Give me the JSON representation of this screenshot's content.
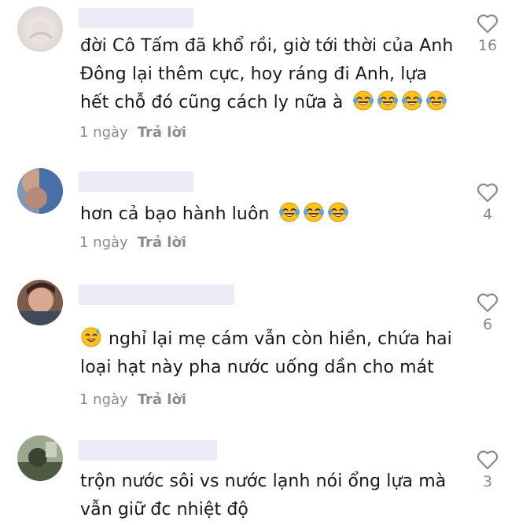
{
  "comments": [
    {
      "text": "đời Cô Tấm đã khổ rồi, giờ tới thời của Anh Đông lại thêm cực, hoy ráng đi Anh, lựa hết chỗ đó cũng cách ly nữa à",
      "emoji_prefix": [],
      "emoji_suffix": [
        "laughing-tears-emoji",
        "laughing-tears-emoji",
        "laughing-tears-emoji",
        "laughing-tears-emoji"
      ],
      "time": "1 ngày",
      "reply_label": "Trả lời",
      "likes": "16",
      "avatar_color": "#e9e4e2"
    },
    {
      "text": "hơn cả bạo hành luôn",
      "emoji_prefix": [],
      "emoji_suffix": [
        "laughing-tears-emoji",
        "laughing-tears-emoji",
        "laughing-tears-emoji"
      ],
      "time": "1 ngày",
      "reply_label": "Trả lời",
      "likes": "4",
      "avatar_color": "#8fa6c4"
    },
    {
      "text": "nghỉ lại mẹ cám vẫn còn hiền, chứa hai loại hạt này pha nước uống dần cho mát",
      "emoji_prefix": [
        "sweat-smile-emoji"
      ],
      "emoji_suffix": [],
      "time": "1 ngày",
      "reply_label": "Trả lời",
      "likes": "6",
      "avatar_color": "#a08070"
    },
    {
      "text": "trộn nước sôi vs nước lạnh nói ổng lựa mà vẫn giữ đc nhiệt độ",
      "emoji_prefix": [],
      "emoji_suffix": [],
      "time": "",
      "reply_label": "",
      "likes": "3",
      "avatar_color": "#6b7a60"
    }
  ],
  "colors": {
    "text": "#161823",
    "meta": "#8a8b91",
    "name_blur": "#ecebf7",
    "like_icon": "#8a8b91"
  },
  "icons": {
    "like": "heart-outline-icon"
  }
}
